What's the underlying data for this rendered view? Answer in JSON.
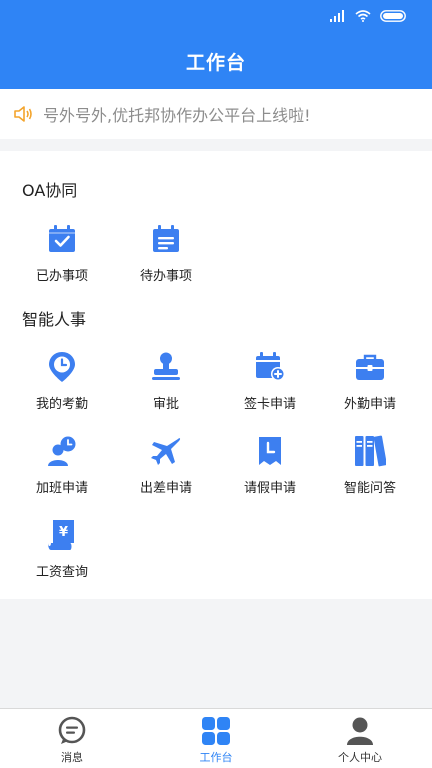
{
  "header": {
    "title": "工作台"
  },
  "notice": {
    "text": "号外号外,优托邦协作办公平台上线啦!"
  },
  "sections": [
    {
      "title": "OA协同",
      "items": [
        {
          "label": "已办事项",
          "icon": "calendar-check-icon"
        },
        {
          "label": "待办事项",
          "icon": "calendar-list-icon"
        }
      ]
    },
    {
      "title": "智能人事",
      "items": [
        {
          "label": "我的考勤",
          "icon": "clock-pin-icon"
        },
        {
          "label": "审批",
          "icon": "stamp-icon"
        },
        {
          "label": "签卡申请",
          "icon": "calendar-add-icon"
        },
        {
          "label": "外勤申请",
          "icon": "briefcase-icon"
        },
        {
          "label": "加班申请",
          "icon": "user-clock-icon"
        },
        {
          "label": "出差申请",
          "icon": "airplane-icon"
        },
        {
          "label": "请假申请",
          "icon": "leave-note-icon"
        },
        {
          "label": "智能问答",
          "icon": "binders-icon"
        },
        {
          "label": "工资查询",
          "icon": "salary-scroll-icon"
        }
      ]
    }
  ],
  "tabbar": {
    "items": [
      {
        "label": "消息",
        "icon": "chat-bubble-icon",
        "active": false
      },
      {
        "label": "工作台",
        "icon": "grid-icon",
        "active": true
      },
      {
        "label": "个人中心",
        "icon": "person-icon",
        "active": false
      }
    ]
  },
  "colors": {
    "primary": "#2f84f5",
    "icon_blue": "#3d7ff0",
    "background": "#f3f4f6"
  }
}
